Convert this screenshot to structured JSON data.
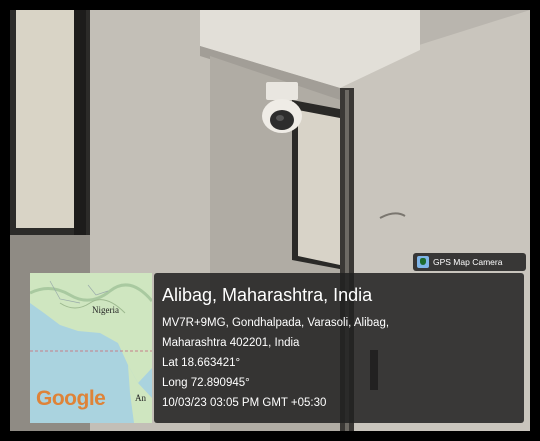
{
  "badge": {
    "app_name": "GPS Map Camera",
    "icon": "gps-map-camera-icon"
  },
  "location": {
    "place": "Alibag, Maharashtra, India",
    "address_line1": "MV7R+9MG, Gondhalpada, Varasoli, Alibag,",
    "address_line2": "Maharashtra 402201, India",
    "latitude": "Lat 18.663421°",
    "longitude": "Long 72.890945°",
    "timestamp": "10/03/23 03:05 PM GMT +05:30"
  },
  "map": {
    "label_country": "Nigeria",
    "label_partial": "An",
    "brand": "Google"
  },
  "colors": {
    "overlay_bg": "#212121",
    "map_sea": "#aad3df",
    "map_land": "#cfe6c0",
    "badge_icon": "#7fb5e8",
    "google_brand": "#e37d2a"
  }
}
